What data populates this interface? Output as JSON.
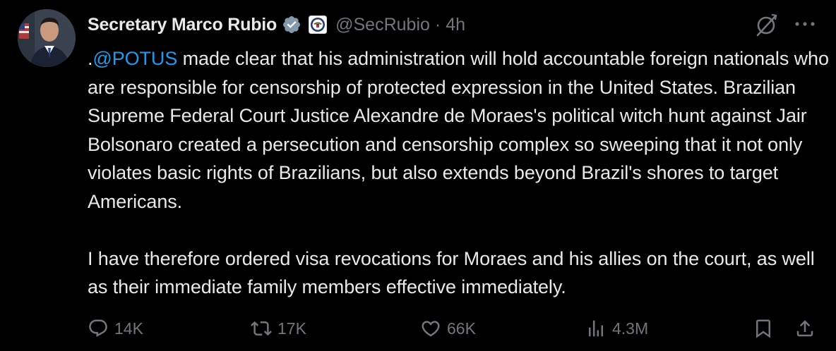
{
  "colors": {
    "background": "#000000",
    "text": "#e7e9ea",
    "muted": "#71767b",
    "link": "#1d9bf0",
    "verified_badge": "#829aab"
  },
  "author": {
    "display_name": "Secretary Marco Rubio",
    "handle": "@SecRubio",
    "separator": "·",
    "timestamp": "4h",
    "verified_icon": "gray-government-verified-badge-icon",
    "affiliate_icon": "state-department-seal-icon"
  },
  "post": {
    "mention": "@POTUS",
    "para1_prefix": ".",
    "para1_text": " made clear that his administration will hold accountable foreign nationals who are responsible for censorship of protected expression in the United States. Brazilian Supreme Federal Court Justice Alexandre de Moraes's political witch hunt against Jair Bolsonaro created a persecution and censorship complex so sweeping that it not only violates basic rights of Brazilians, but also extends beyond Brazil's shores to target Americans.",
    "para2_text": "I have therefore ordered visa revocations for Moraes and his allies on the court, as well as their immediate family members effective immediately."
  },
  "actions": {
    "replies": "14K",
    "reposts": "17K",
    "likes": "66K",
    "views": "4.3M"
  },
  "icons": {
    "grok": "grok-icon",
    "more": "more-options-icon",
    "reply": "reply-icon",
    "repost": "repost-icon",
    "like": "heart-icon",
    "views": "views-chart-icon",
    "bookmark": "bookmark-icon",
    "share": "share-icon"
  }
}
